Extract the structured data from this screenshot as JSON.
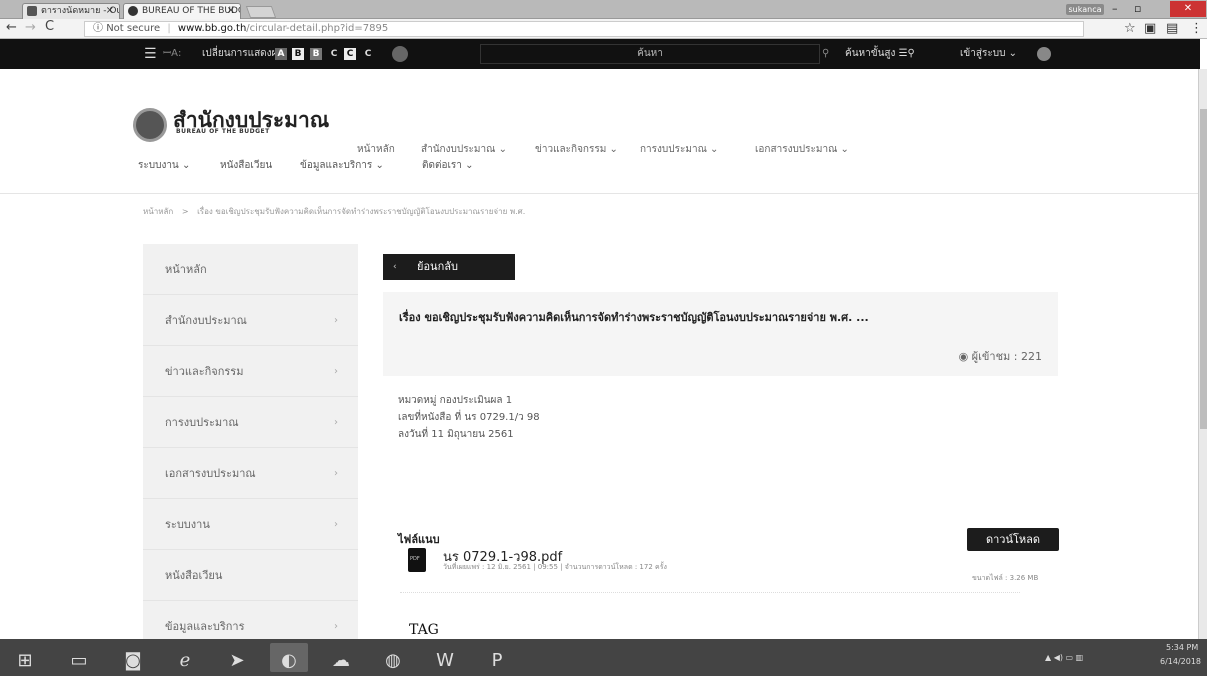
{
  "browser": {
    "tabs": [
      {
        "label": "ตารางนัดหมาย - Outlook"
      },
      {
        "label": "BUREAU OF THE BUDGET"
      }
    ],
    "user_badge": "sukanca",
    "address": {
      "security": "Not secure",
      "host": "www.bb.go.th",
      "path": "/circular-detail.php?id=7895"
    }
  },
  "topbar": {
    "hamburger": "☰",
    "icon_font_sizer": "ꟷA꞉",
    "display_mode": "เปลี่ยนการแสดงผล",
    "modes": [
      "A",
      "B",
      "B",
      "C",
      "C",
      "C"
    ],
    "search_placeholder": "ค้นหา",
    "advanced_search": "ค้นหาขั้นสูง",
    "login": "เข้าสู่ระบบ"
  },
  "site": {
    "name_thai": "สำนักงบประมาณ",
    "name_eng": "BUREAU OF THE BUDGET",
    "menu_primary": [
      "หน้าหลัก",
      "สำนักงบประมาณ",
      "ข่าวและกิจกรรม",
      "การงบประมาณ",
      "เอกสารงบประมาณ"
    ],
    "menu_secondary": [
      "ระบบงาน",
      "หนังสือเวียน",
      "ข้อมูลและบริการ",
      "ติดต่อเรา"
    ]
  },
  "breadcrumb": {
    "home": "หน้าหลัก",
    "separator": ">",
    "current": "เรื่อง ขอเชิญประชุมรับฟังความคิดเห็นการจัดทำร่างพระราชบัญญัติโอนงบประมาณรายจ่าย พ.ศ."
  },
  "sidebar": {
    "items": [
      {
        "label": "หน้าหลัก"
      },
      {
        "label": "สำนักงบประมาณ"
      },
      {
        "label": "ข่าวและกิจกรรม"
      },
      {
        "label": "การงบประมาณ"
      },
      {
        "label": "เอกสารงบประมาณ"
      },
      {
        "label": "ระบบงาน"
      },
      {
        "label": "หนังสือเวียน"
      },
      {
        "label": "ข้อมูลและบริการ"
      }
    ]
  },
  "content": {
    "back_label": "ย้อนกลับ",
    "title": "เรื่อง ขอเชิญประชุมรับฟังความคิดเห็นการจัดทำร่างพระราชบัญญัติโอนงบประมาณรายจ่าย พ.ศ. ...",
    "views": "ผู้เข้าชม : 221",
    "category": "หมวดหมู่ กองประเมินผล 1",
    "doc_number": "เลขที่หนังสือ ที่ นร 0729.1/ว 98",
    "date": "ลงวันที่ 11 มิถุนายน 2561",
    "attachments_heading": "ไฟล์แนบ",
    "attachment": {
      "filename": "นร 0729.1-ว98.pdf",
      "meta": "วันที่เผยแพร่ : 12 มิ.ย. 2561  |  09:55  |  จำนวนการดาวน์โหลด : 172 ครั้ง",
      "download_label": "ดาวน์โหลด",
      "size": "ขนาดไฟล์ : 3.26 MB"
    },
    "tag_label": "TAG"
  },
  "taskbar": {
    "clock_time": "5:34 PM",
    "clock_date": "6/14/2018"
  }
}
